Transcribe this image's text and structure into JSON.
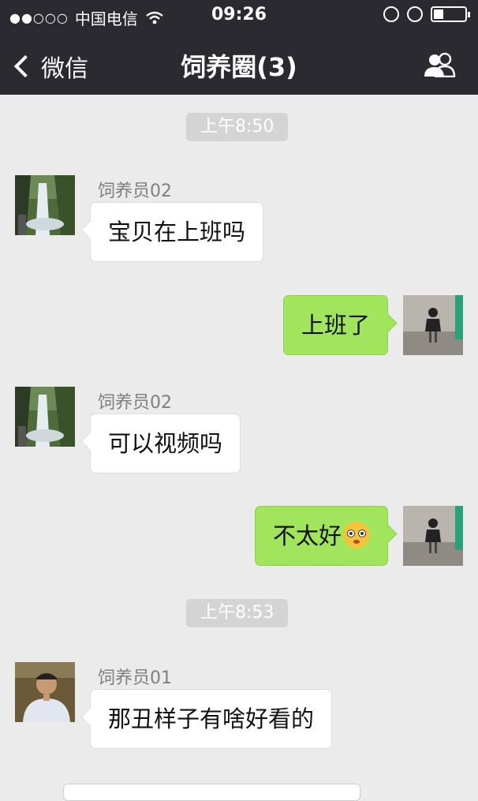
{
  "status_bar": {
    "signal": "●●○○○",
    "carrier": "中国电信",
    "time": "09:26"
  },
  "nav": {
    "back_label": "微信",
    "title": "饲养圈(3)",
    "group_icon": "group-members-icon"
  },
  "messages": [
    {
      "type": "time",
      "text": "上午8:50"
    },
    {
      "type": "in",
      "sender": "饲养员02",
      "text": "宝贝在上班吗",
      "avatar": "waterfall-photo"
    },
    {
      "type": "out",
      "text": "上班了",
      "avatar": "girl-photo"
    },
    {
      "type": "in",
      "sender": "饲养员02",
      "text": "可以视频吗",
      "avatar": "waterfall-photo"
    },
    {
      "type": "out",
      "text": "不太好",
      "emoji": "flushed-face-emoji",
      "avatar": "girl-photo"
    },
    {
      "type": "time",
      "text": "上午8:53"
    },
    {
      "type": "in",
      "sender": "饲养员01",
      "text": "那丑样子有啥好看的",
      "avatar": "man-photo"
    }
  ],
  "colors": {
    "header_bg": "#2b2a30",
    "chat_bg": "#ebebeb",
    "outgoing_bubble": "#a0e55c",
    "incoming_bubble": "#ffffff"
  }
}
